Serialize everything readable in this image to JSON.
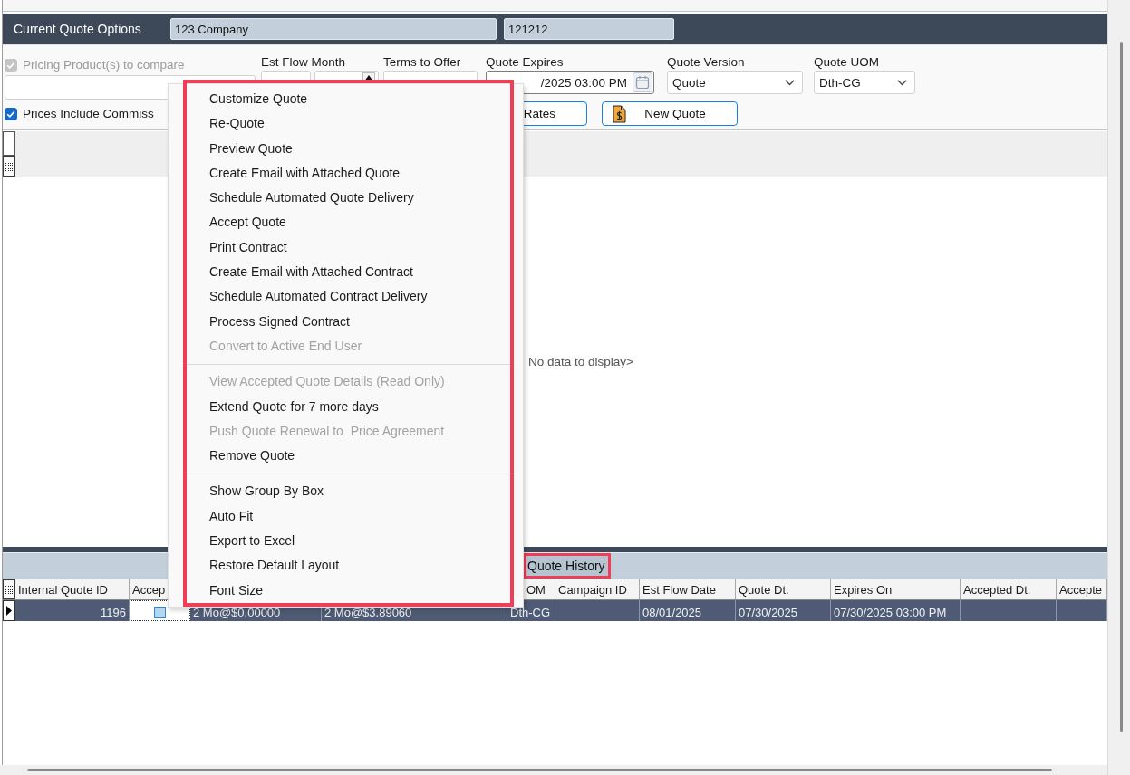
{
  "header": {
    "title": "Current Quote Options",
    "fields": [
      "123 Company",
      "121212"
    ]
  },
  "form": {
    "options": [
      {
        "label": "Pricing Product(s) to compare",
        "checked": true,
        "disabled": true
      },
      {
        "label": "Prices Include Commiss",
        "checked": true,
        "disabled": false
      }
    ],
    "fields": [
      {
        "kind": "month",
        "label": "Est Flow Month"
      },
      {
        "kind": "text",
        "label": "Terms to Offer"
      },
      {
        "kind": "date",
        "label": "Quote Expires",
        "value": "/2025 03:00 PM"
      },
      {
        "kind": "select",
        "label": "Quote Version",
        "value": "Quote"
      },
      {
        "kind": "select",
        "label": "Quote UOM",
        "value": "Dth-CG"
      }
    ],
    "buttons": [
      {
        "kind": "text",
        "label": "Rates"
      },
      {
        "kind": "icon_text",
        "label": "New Quote"
      }
    ]
  },
  "quotes_grid": {
    "empty_text": "No data to display>"
  },
  "quote_history": {
    "title": "Quote History",
    "highlighted": true,
    "columns": [
      "Internal Quote ID",
      "Accep",
      "",
      "",
      "OM",
      "Campaign ID",
      "Est Flow Date",
      "Quote Dt.",
      "Expires On",
      "Accepted Dt.",
      "Accepte"
    ],
    "rows": [
      {
        "selected": true,
        "cells": [
          {
            "kind": "text",
            "text": "1196"
          },
          {
            "kind": "check",
            "checked": false
          },
          {
            "kind": "text",
            "text": "2 Mo@$0.00000"
          },
          {
            "kind": "text",
            "text": "2 Mo@$3.89060"
          },
          {
            "kind": "text",
            "text": "Dth-CG"
          },
          {
            "kind": "empty"
          },
          {
            "kind": "text",
            "text": "08/01/2025"
          },
          {
            "kind": "text",
            "text": "07/30/2025"
          },
          {
            "kind": "text",
            "text": "07/30/2025 03:00 PM"
          },
          {
            "kind": "empty"
          },
          {
            "kind": "empty"
          }
        ]
      }
    ]
  },
  "context_menu": {
    "highlighted": true,
    "groups": [
      {
        "items": [
          {
            "label": "Customize Quote",
            "disabled": false
          },
          {
            "label": "Re-Quote",
            "disabled": false
          },
          {
            "label": "Preview Quote",
            "disabled": false
          },
          {
            "label": "Create Email with Attached Quote",
            "disabled": false
          },
          {
            "label": "Schedule Automated Quote Delivery",
            "disabled": false
          },
          {
            "label": "Accept Quote",
            "disabled": false
          },
          {
            "label": "Print Contract",
            "disabled": false
          },
          {
            "label": "Create Email with Attached Contract",
            "disabled": false
          },
          {
            "label": "Schedule Automated Contract Delivery",
            "disabled": false
          },
          {
            "label": "Process Signed Contract",
            "disabled": false
          },
          {
            "label": "Convert to Active End User",
            "disabled": true
          }
        ]
      },
      {
        "items": [
          {
            "label": "View Accepted Quote Details (Read Only)",
            "disabled": true
          },
          {
            "label": "Extend Quote for 7 more days",
            "disabled": false
          },
          {
            "label": "Push Quote Renewal to  Price Agreement",
            "disabled": true
          },
          {
            "label": "Remove Quote",
            "disabled": false
          }
        ]
      },
      {
        "items": [
          {
            "label": "Show Group By Box",
            "disabled": false
          },
          {
            "label": "Auto Fit",
            "disabled": false
          },
          {
            "label": "Export to Excel",
            "disabled": false
          },
          {
            "label": "Restore Default Layout",
            "disabled": false
          },
          {
            "label": "Font Size",
            "disabled": false
          }
        ]
      }
    ]
  }
}
